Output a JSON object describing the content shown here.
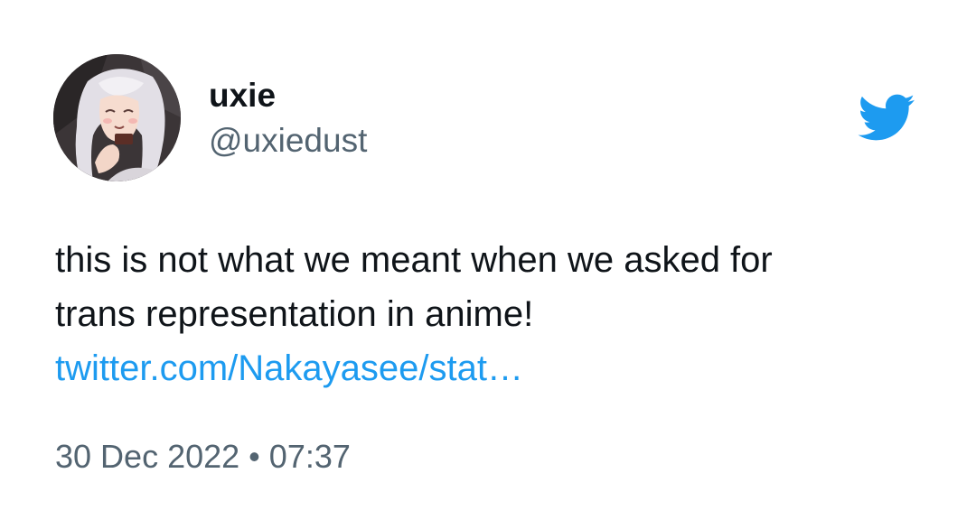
{
  "tweet": {
    "author": {
      "display_name": "uxie",
      "handle": "@uxiedust",
      "avatar": "anime-girl-avatar"
    },
    "text_lines": [
      "this is not what we meant when we asked for",
      "trans representation in anime!"
    ],
    "link_text": "twitter.com/Nakayasee/stat…",
    "date": "30 Dec 2022",
    "separator": "•",
    "time": "07:37"
  },
  "icons": {
    "logo": "twitter-bird-icon"
  },
  "colors": {
    "brand": "#1d9bf0",
    "text_primary": "#0f1419",
    "text_secondary": "#536471",
    "background": "#ffffff"
  }
}
